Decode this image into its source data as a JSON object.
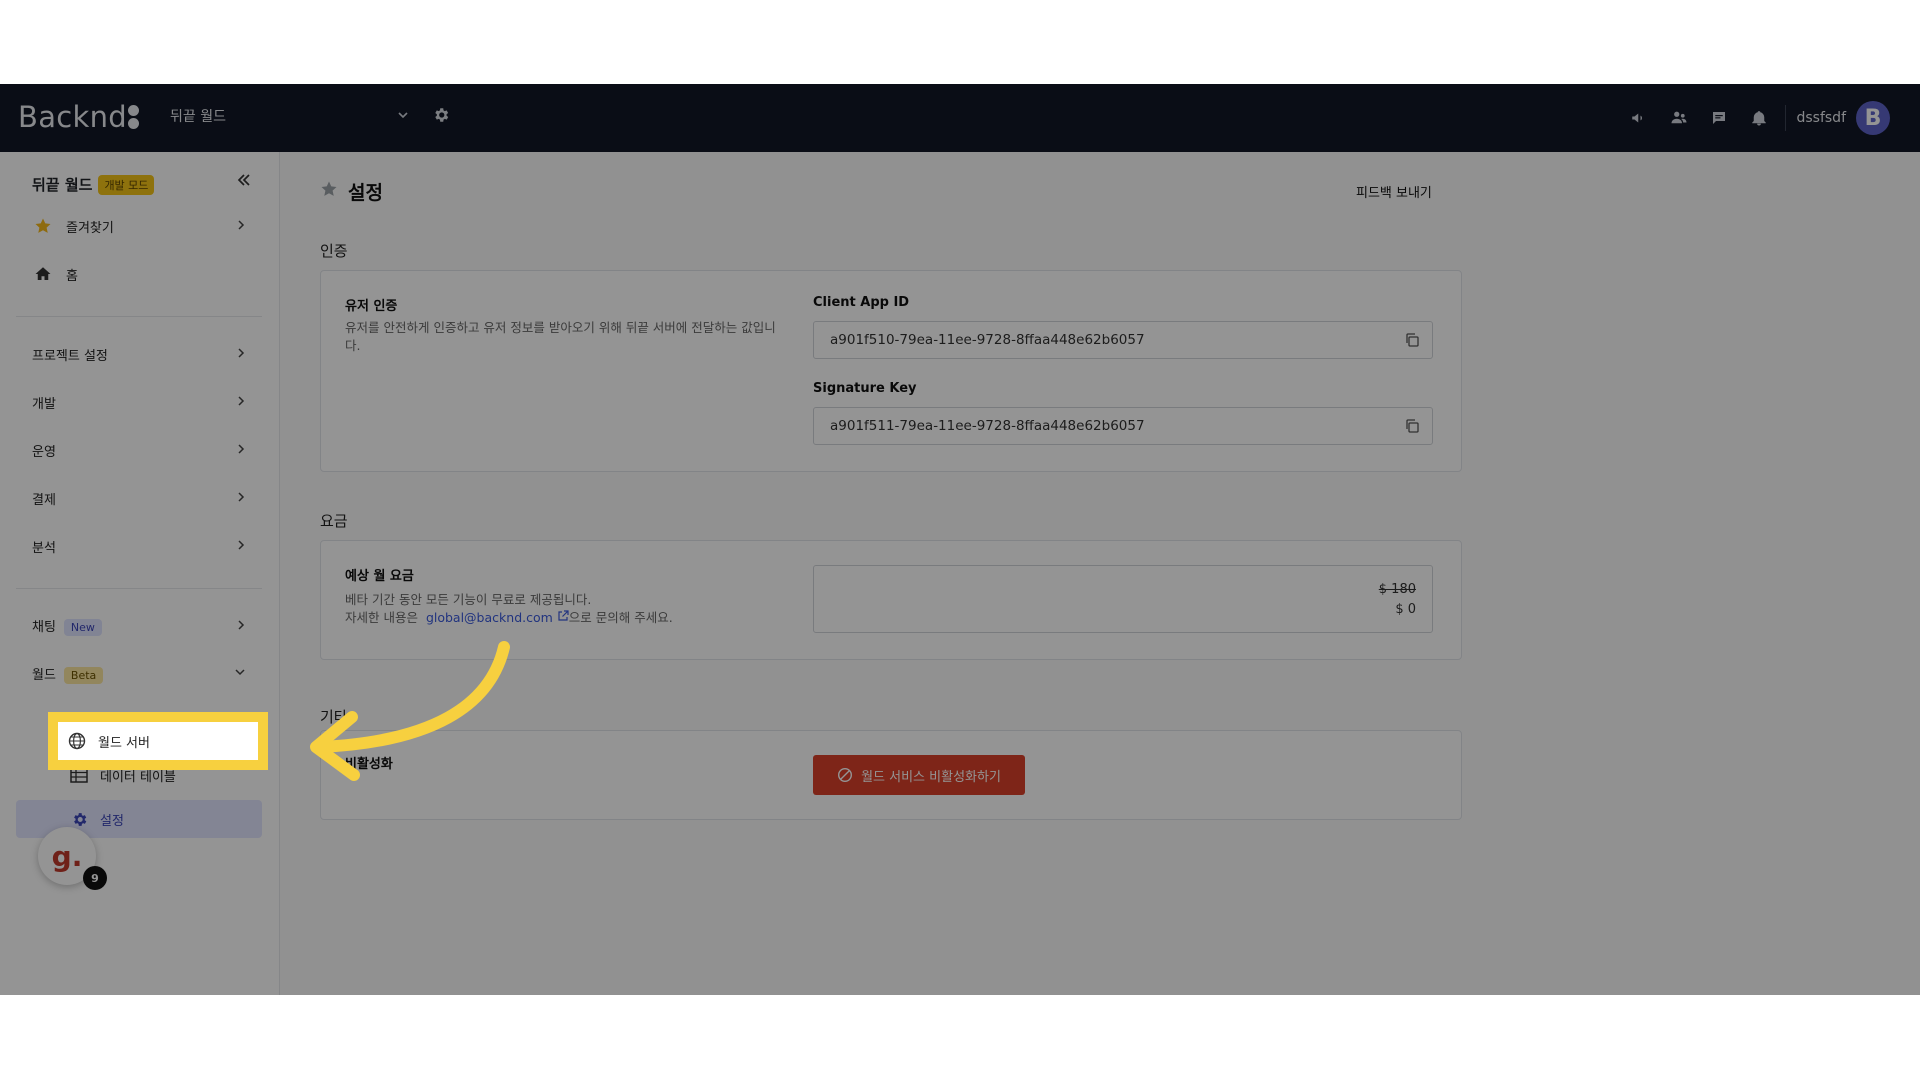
{
  "topbar": {
    "logo": "Backnd",
    "project_name": "뒤끝 월드",
    "user_name": "dssfsdf",
    "avatar_letter": "B",
    "icons": [
      "megaphone-icon",
      "people-icon",
      "chat-icon",
      "bell-icon"
    ]
  },
  "sidebar": {
    "project_title": "뒤끝 월드",
    "mode_badge": "개발 모드",
    "items": [
      {
        "label": "즐겨찾기",
        "icon": "star-icon"
      },
      {
        "label": "홈",
        "icon": "home-icon"
      },
      {
        "label": "프로젝트 설정"
      },
      {
        "label": "개발"
      },
      {
        "label": "운영"
      },
      {
        "label": "결제"
      },
      {
        "label": "분석"
      },
      {
        "label": "채팅",
        "badge": "New"
      },
      {
        "label": "월드",
        "badge": "Beta"
      }
    ],
    "world_sub": [
      {
        "label": "월드 서버",
        "icon": "globe-icon"
      },
      {
        "label": "데이터 테이블",
        "icon": "table-icon"
      },
      {
        "label": "설정",
        "icon": "gear-icon"
      }
    ],
    "help_letter": "g.",
    "help_count": "9"
  },
  "main": {
    "title": "설정",
    "feedback": "피드백 보내기",
    "auth": {
      "section": "인증",
      "card_title": "유저 인증",
      "card_desc": "유저를 안전하게 인증하고 유저 정보를 받아오기 위해 뒤끝 서버에 전달하는 값입니다.",
      "client_app_id_label": "Client App ID",
      "client_app_id": "a901f510-79ea-11ee-9728-8ffaa448e62b6057",
      "signature_key_label": "Signature Key",
      "signature_key": "a901f511-79ea-11ee-9728-8ffaa448e62b6057"
    },
    "fee": {
      "section": "요금",
      "card_title": "예상 월 요금",
      "desc_line1": "베타 기간 동안 모든 기능이 무료로 제공됩니다.",
      "desc_prefix": "자세한 내용은",
      "email": "global@backnd.com",
      "desc_suffix": "으로 문의해 주세요.",
      "old_price": "$ 180",
      "new_price": "$ 0"
    },
    "deactivate": {
      "section": "기타",
      "card_title": "비활성화",
      "button": "월드 서비스 비활성화하기"
    }
  }
}
